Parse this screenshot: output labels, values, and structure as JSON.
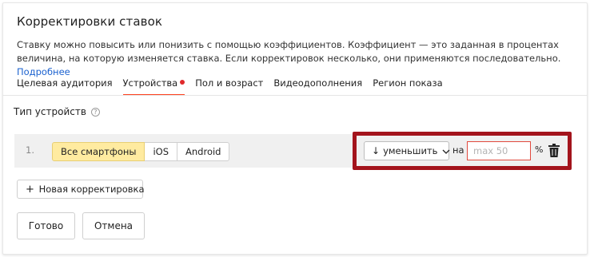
{
  "panel": {
    "title": "Корректировки ставок",
    "description": "Ставку можно повысить или понизить с помощью коэффициентов. Коэффициент — это заданная в процентах величина, на которую изменяется ставка. Если корректировок несколько, они применяются последовательно.",
    "more_link": "Подробнее"
  },
  "tabs": [
    {
      "label": "Целевая аудитория",
      "active": false
    },
    {
      "label": "Устройства",
      "active": true,
      "has_indicator": true
    },
    {
      "label": "Пол и возраст",
      "active": false
    },
    {
      "label": "Видеодополнения",
      "active": false
    },
    {
      "label": "Регион показа",
      "active": false
    }
  ],
  "device_section": {
    "label": "Тип устройств",
    "help_icon": "question-circle-icon"
  },
  "adjustment_row": {
    "number": "1.",
    "devices": [
      {
        "label": "Все смартфоны",
        "selected": true
      },
      {
        "label": "iOS",
        "selected": false
      },
      {
        "label": "Android",
        "selected": false
      }
    ],
    "direction_arrow": "↓",
    "direction_label": "уменьшить",
    "connector": "на",
    "value_placeholder": "max 50",
    "value": "",
    "unit": "%",
    "delete_icon": "trash-icon"
  },
  "actions": {
    "add_label": "Новая корректировка",
    "done_label": "Готово",
    "cancel_label": "Отмена"
  },
  "colors": {
    "active_tab_underline": "#fc3f1d",
    "tab_indicator": "#e0292b",
    "selected_segment": "#ffeba0",
    "link": "#1a61cf",
    "highlight_box": "#a3141c",
    "input_border": "#e14a3e"
  }
}
